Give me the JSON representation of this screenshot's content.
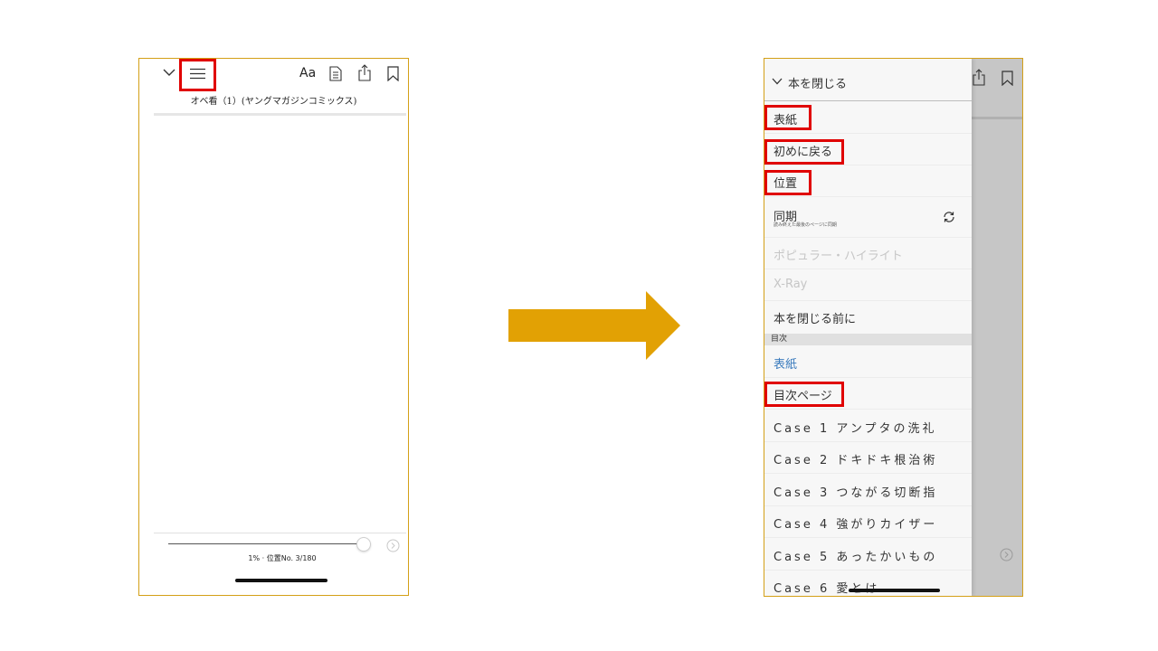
{
  "left_screen": {
    "toolbar": {
      "collapse_icon": "chevron-down-icon",
      "menu_icon": "hamburger-menu-icon",
      "font_button_label": "Aa",
      "notes_icon": "document-icon",
      "share_icon": "share-icon",
      "bookmark_icon": "bookmark-icon"
    },
    "book_title": "オベ看（1）(ヤングマガジンコミックス)",
    "progress": {
      "percent": 1,
      "location_current": 3,
      "location_total": 180,
      "label": "1% · 位置No. 3/180"
    },
    "next_icon": "chevron-right-circle-icon"
  },
  "right_screen": {
    "menu": {
      "close_book_label": "本を閉じる",
      "items": [
        {
          "label": "表紙"
        },
        {
          "label": "初めに戻る"
        },
        {
          "label": "位置"
        },
        {
          "label": "同期",
          "sublabel": "読み終えた最後のページに同期",
          "icon": "sync-icon"
        },
        {
          "label": "ポピュラー・ハイライト",
          "enabled": false
        },
        {
          "label": "X-Ray",
          "enabled": false
        },
        {
          "label": "本を閉じる前に"
        }
      ],
      "toc_header": "目次",
      "toc_items": [
        {
          "label": "表紙"
        },
        {
          "label": "目次ページ"
        },
        {
          "label": "Case 1 アンプタの洗礼"
        },
        {
          "label": "Case 2 ドキドキ根治術"
        },
        {
          "label": "Case 3 つながる切断指"
        },
        {
          "label": "Case 4 強がりカイザー"
        },
        {
          "label": "Case 5 あったかいもの"
        },
        {
          "label": "Case 6 愛とは"
        }
      ]
    },
    "background_toolbar": {
      "share_icon": "share-icon",
      "bookmark_icon": "bookmark-icon"
    }
  },
  "highlight_color": "#e00000",
  "arrow_color": "#e2a104",
  "frame_color": "#d4a017",
  "link_color": "#3a7bbd"
}
